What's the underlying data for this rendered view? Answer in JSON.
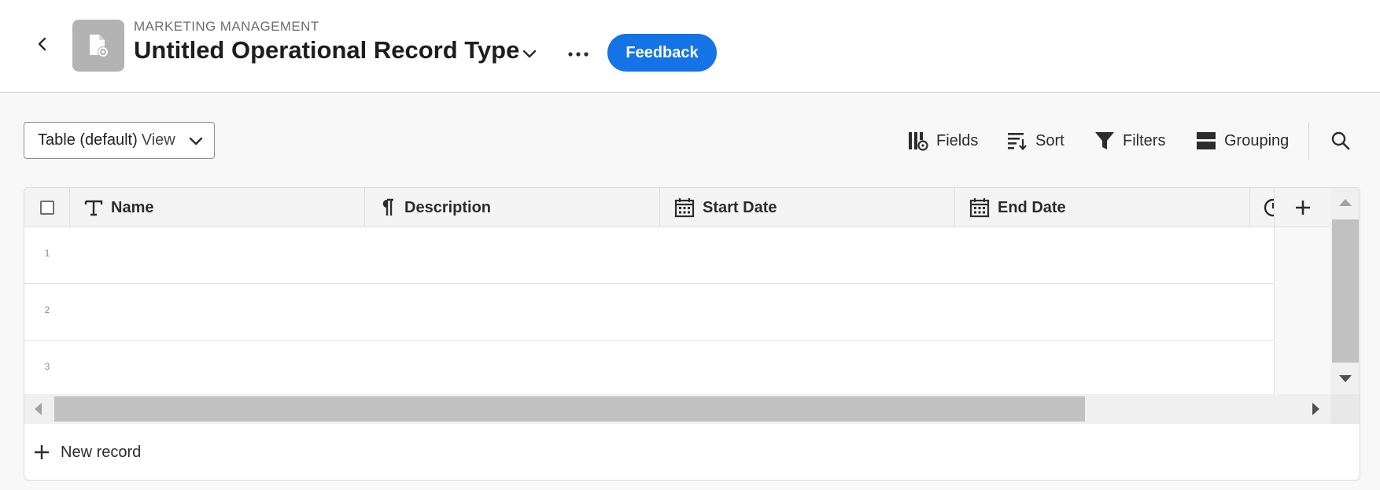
{
  "header": {
    "back_label": "Back",
    "eyebrow": "MARKETING MANAGEMENT",
    "title": "Untitled Operational Record Type",
    "feedback_label": "Feedback"
  },
  "toolbar": {
    "view_name": "Table (default)",
    "view_suffix": "View",
    "fields_label": "Fields",
    "sort_label": "Sort",
    "filters_label": "Filters",
    "grouping_label": "Grouping"
  },
  "table": {
    "columns": [
      {
        "label": "Name",
        "icon": "text-type-icon"
      },
      {
        "label": "Description",
        "icon": "paragraph-icon"
      },
      {
        "label": "Start Date",
        "icon": "calendar-icon"
      },
      {
        "label": "End Date",
        "icon": "calendar-icon"
      }
    ],
    "row_numbers": [
      "1",
      "2",
      "3"
    ],
    "new_record_label": "New record"
  },
  "colors": {
    "accent": "#1473e6",
    "record_icon_bg": "#b3b3b3"
  }
}
